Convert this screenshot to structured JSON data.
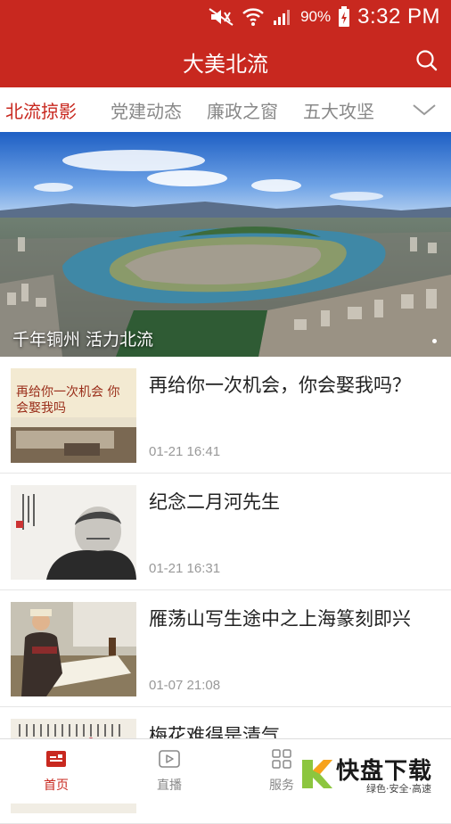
{
  "status_bar": {
    "battery": "90%",
    "time": "3:32 PM"
  },
  "header": {
    "title": "大美北流"
  },
  "tabs": [
    {
      "label": "北流掠影",
      "active": true
    },
    {
      "label": "党建动态",
      "active": false
    },
    {
      "label": "廉政之窗",
      "active": false
    },
    {
      "label": "五大攻坚",
      "active": false
    }
  ],
  "banner": {
    "caption": "千年铜州  活力北流"
  },
  "news": [
    {
      "title": "再给你一次机会，你会娶我吗？",
      "date": "01-21 16:41",
      "thumb_text": "再给你一次机会 你会娶我吗"
    },
    {
      "title": "纪念二月河先生",
      "date": "01-21 16:31"
    },
    {
      "title": "雁荡山写生途中之上海篆刻即兴",
      "date": "01-07 21:08"
    },
    {
      "title": "梅花难得是清气",
      "date": ""
    }
  ],
  "bottom_nav": [
    {
      "label": "首页",
      "icon": "home-icon",
      "active": true
    },
    {
      "label": "直播",
      "icon": "play-icon",
      "active": false
    },
    {
      "label": "服务",
      "icon": "grid-icon",
      "active": false
    }
  ],
  "watermark": {
    "brand": "快盘下载",
    "sub": "绿色·安全·高速"
  },
  "colors": {
    "primary": "#c8281f",
    "text": "#222222",
    "muted": "#888888"
  }
}
